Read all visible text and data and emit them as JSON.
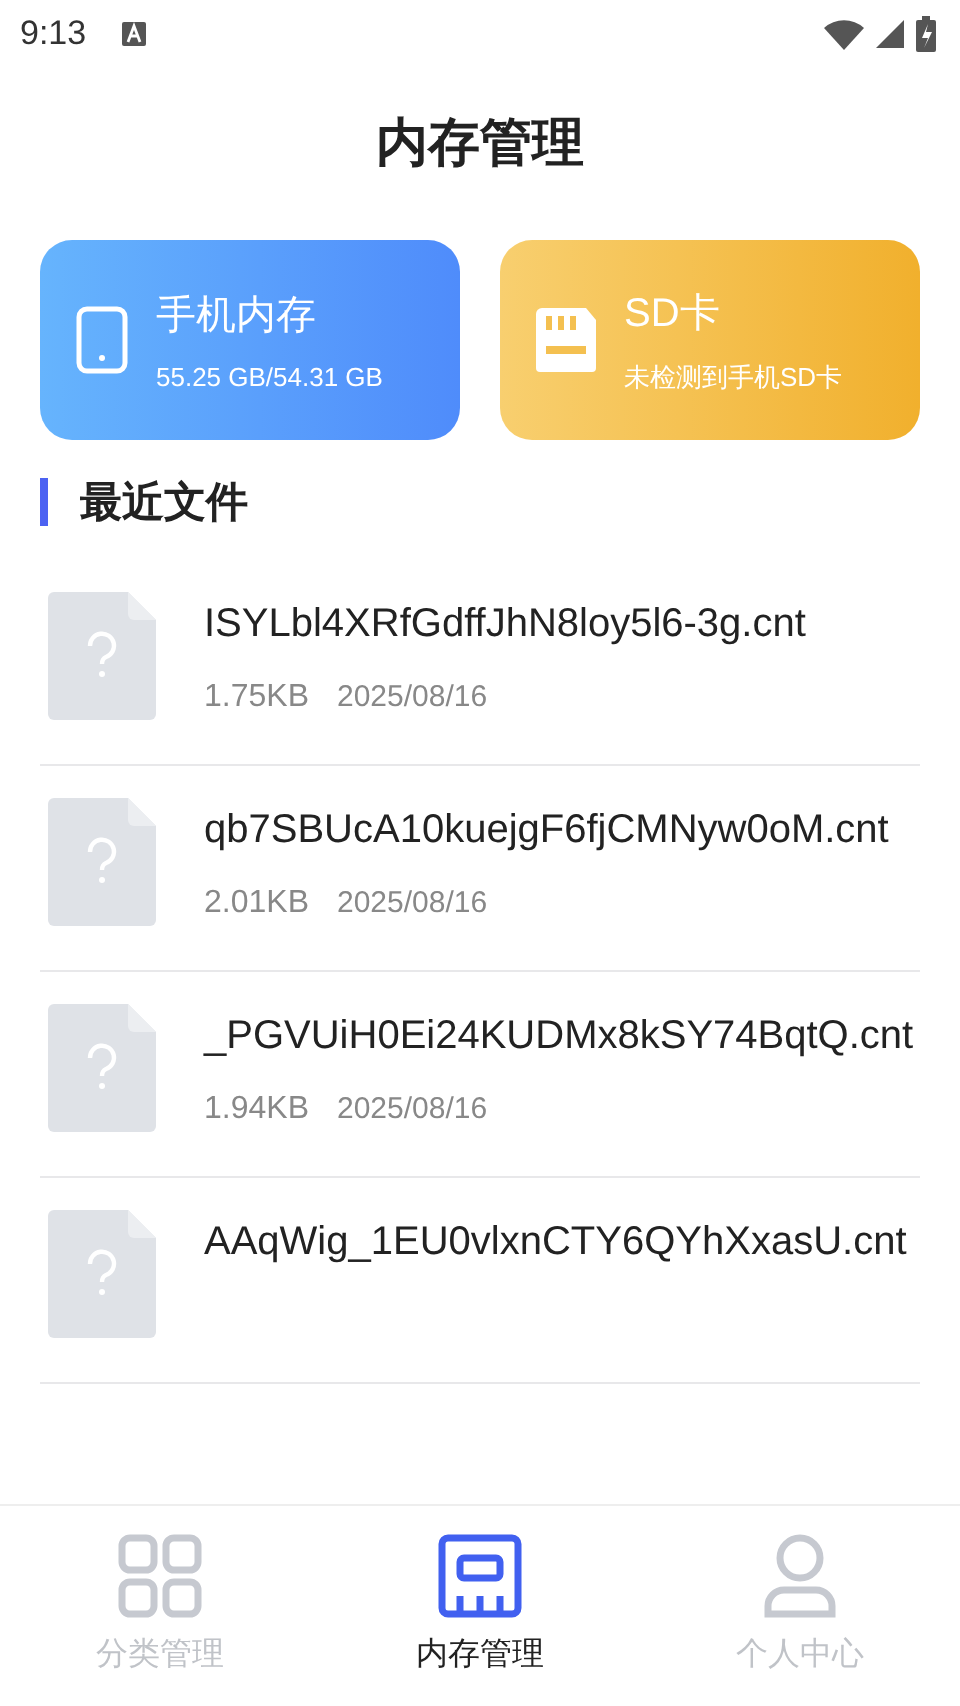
{
  "status_bar": {
    "time": "9:13"
  },
  "title": "内存管理",
  "storage_cards": [
    {
      "kind": "phone",
      "title": "手机内存",
      "subtitle": "55.25 GB/54.31 GB"
    },
    {
      "kind": "sd",
      "title": "SD卡",
      "subtitle": "未检测到手机SD卡"
    }
  ],
  "section_title": "最近文件",
  "files": [
    {
      "name": "ISYLbl4XRfGdffJhN8loy5l6-3g.cnt",
      "size": "1.75KB",
      "date": "2025/08/16"
    },
    {
      "name": "qb7SBUcA10kuejgF6fjCMNyw0oM.cnt",
      "size": "2.01KB",
      "date": "2025/08/16"
    },
    {
      "name": "_PGVUiH0Ei24KUDMx8kSY74BqtQ.cnt",
      "size": "1.94KB",
      "date": "2025/08/16"
    },
    {
      "name": "AAqWig_1EU0vlxnCTY6QYhXxasU.cnt"
    }
  ],
  "bottom_nav": [
    {
      "kind": "grid",
      "label": "分类管理",
      "selected": false
    },
    {
      "kind": "storage",
      "label": "内存管理",
      "selected": true
    },
    {
      "kind": "person",
      "label": "个人中心",
      "selected": false
    }
  ]
}
